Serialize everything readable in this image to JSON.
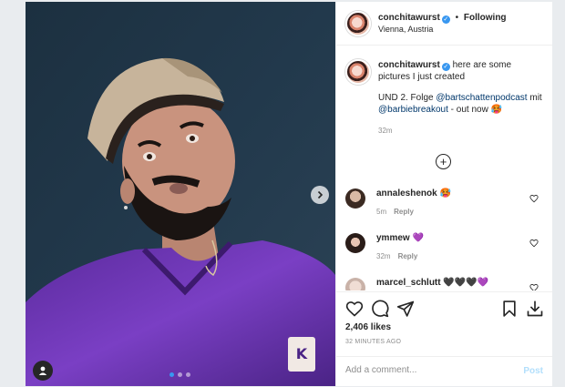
{
  "post": {
    "username": "conchitawurst",
    "follow_separator": "•",
    "follow_label": "Following",
    "location": "Vienna, Austria"
  },
  "caption": {
    "username": "conchitawurst",
    "text1": "here are some pictures I just created",
    "text2_prefix": "UND 2. Folge",
    "mention1": "@bartschattenpodcast",
    "text2_mid": "mit",
    "mention2": "@barbiebreakout",
    "text2_suffix": "- out now 🥵",
    "time": "32m"
  },
  "load_more": "+",
  "comments": [
    {
      "username": "annaleshenok",
      "text": "🥵",
      "time": "5m",
      "reply_label": "Reply"
    },
    {
      "username": "ymmew",
      "text": "💜",
      "time": "32m",
      "reply_label": "Reply"
    },
    {
      "username": "marcel_schlutt",
      "text": "🖤🖤🖤💜"
    }
  ],
  "engagement": {
    "likes": "2,406 likes",
    "time_ago": "32 MINUTES AGO"
  },
  "comment_box": {
    "placeholder": "Add a comment...",
    "post_label": "Post"
  },
  "carousel": {
    "count": 3,
    "active_index": 0
  },
  "colors": {
    "accent": "#3897f0",
    "link": "#00376b",
    "post_disabled": "#b2dffc"
  },
  "icons": [
    "next-arrow-icon",
    "user-tag-icon",
    "verified-badge-icon",
    "heart-icon",
    "comment-icon",
    "share-icon",
    "bookmark-icon",
    "download-icon",
    "add-circle-icon"
  ]
}
